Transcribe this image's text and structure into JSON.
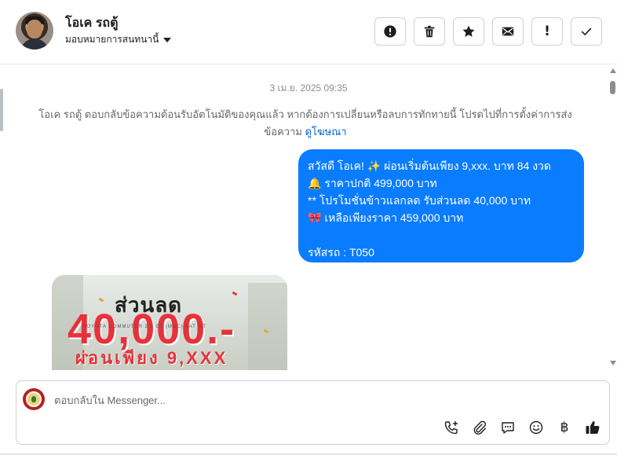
{
  "header": {
    "contact_name": "โอเค รถตู้",
    "assign_label": "มอบหมายการสนทนานี้",
    "actions": [
      {
        "name": "report-button",
        "icon": "exclamation-circle-icon"
      },
      {
        "name": "delete-button",
        "icon": "trash-icon"
      },
      {
        "name": "star-button",
        "icon": "star-icon"
      },
      {
        "name": "mark-unread-button",
        "icon": "envelope-icon"
      },
      {
        "name": "important-button",
        "icon": "exclamation-icon",
        "glyph": "!"
      },
      {
        "name": "mark-done-button",
        "icon": "check-icon"
      }
    ]
  },
  "conversation": {
    "timestamp": "3 เม.ย. 2025 09:35",
    "auto_reply_text": "โอเค รถตู้ ตอบกลับข้อความต้อนรับอัตโนมัติของคุณแล้ว หากต้องการเปลี่ยนหรือลบการทักทายนี้ โปรดไปที่การตั้งค่าการส่งข้อความ",
    "auto_reply_link": "ดูโฆษณา",
    "message_lines": [
      "สวัสดี โอเค! ✨  ผ่อนเริ่มต้นเพียง 9,xxx. บาท 84 งวด",
      "🔔 ราคาปกติ 499,000 บาท",
      "** โปรโมชั่นข้าวแลกลด รับส่วนลด 40,000 บาท",
      "🎀  เหลือเพียงราคา 459,000 บาท",
      "",
      "รหัสรถ : T050"
    ],
    "attachment": {
      "headline": "ส่วนลด",
      "amount": "40,000.-",
      "subline": "ผ่อนเพียง 9,XXX",
      "fine_print": "TOYOTA COMMUTER 2.8 GL (MNC) 6AT MT"
    }
  },
  "composer": {
    "placeholder": "ตอบกลับใน Messenger...",
    "tools": [
      {
        "name": "call-button",
        "icon": "phone-plus-icon"
      },
      {
        "name": "attach-button",
        "icon": "paperclip-icon"
      },
      {
        "name": "saved-reply-button",
        "icon": "chat-bubble-icon"
      },
      {
        "name": "emoji-button",
        "icon": "smiley-icon"
      },
      {
        "name": "payment-button",
        "icon": "baht-icon",
        "glyph": "฿"
      },
      {
        "name": "like-button",
        "icon": "thumbs-up-icon"
      }
    ]
  },
  "colors": {
    "bubble": "#0a7cff",
    "link": "#0064d1",
    "muted_text": "#65676b",
    "border": "#ced0d4"
  }
}
